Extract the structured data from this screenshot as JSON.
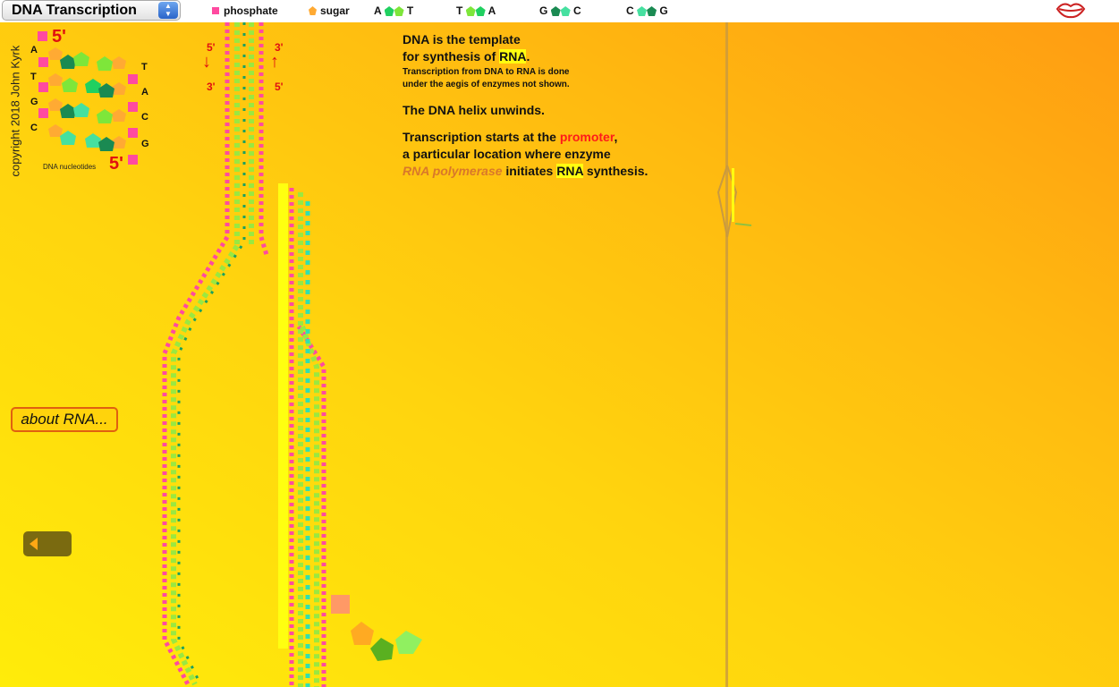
{
  "app": {
    "title": "DNA Transcription"
  },
  "legend": {
    "phosphate": "phosphate",
    "sugar": "sugar",
    "pairs": [
      {
        "left": "A",
        "right": "T"
      },
      {
        "left": "T",
        "right": "A"
      },
      {
        "left": "G",
        "right": "C"
      },
      {
        "left": "C",
        "right": "G"
      }
    ]
  },
  "sidebar": {
    "copyright": "copyright 2018 John Kyrk",
    "nucleotides_label": "DNA nucleotides",
    "five_prime_top": "5'",
    "five_prime_bottom": "5'",
    "left_bases": [
      "A",
      "T",
      "G",
      "C"
    ],
    "right_bases": [
      "T",
      "A",
      "C",
      "G"
    ]
  },
  "strands": {
    "left_top": "5'",
    "left_bottom": "3'",
    "right_top": "3'",
    "right_bottom": "5'"
  },
  "info": {
    "line1": "DNA is the template",
    "line2_pre": "for synthesis of ",
    "line2_hl": "RNA",
    "line2_post": ".",
    "small1": "Transcription from DNA to RNA is done",
    "small2": "under the aegis of enzymes not shown.",
    "unwinds": "The DNA helix unwinds.",
    "t1_pre": "Transcription starts at the ",
    "t1_red": "promoter",
    "t1_post": ",",
    "t2": "a particular location where enzyme",
    "t3_italic": "RNA polymerase",
    "t3_mid": " initiates ",
    "t3_hl": "RNA",
    "t3_post": " synthesis."
  },
  "buttons": {
    "about": "about RNA..."
  },
  "colors": {
    "phosphate": "#ff4aa0",
    "sugar": "#ffaa33",
    "accent_red": "#e01010",
    "rna_highlight": "#ffff10"
  }
}
